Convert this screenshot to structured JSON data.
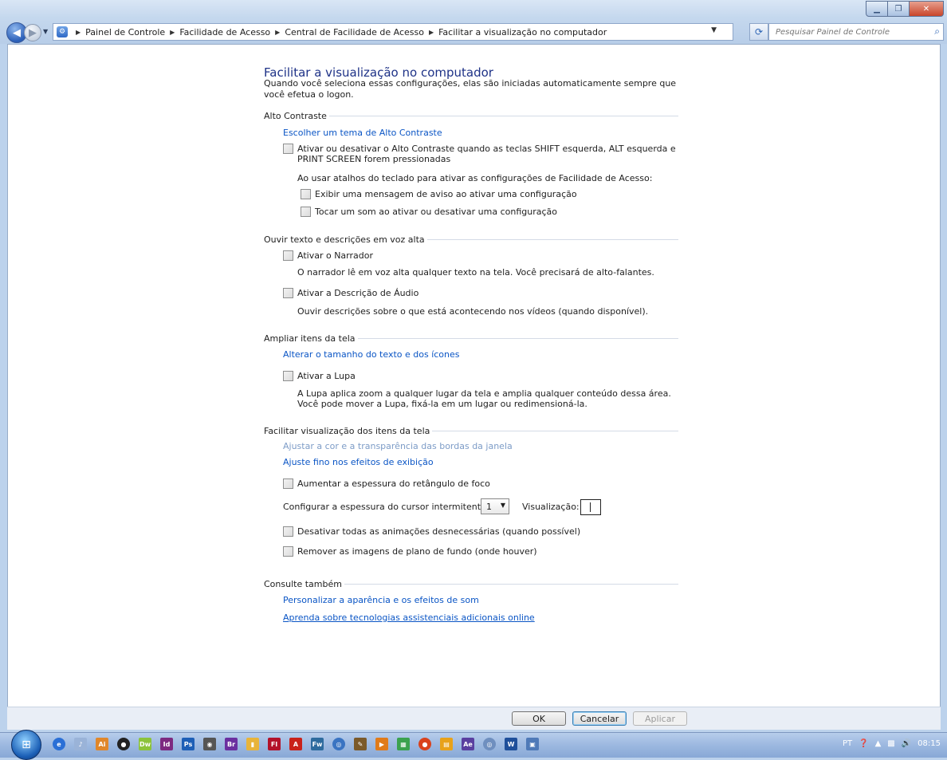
{
  "address": {
    "crumbs": [
      "Painel de Controle",
      "Facilidade de Acesso",
      "Central de Facilidade de Acesso",
      "Facilitar a visualização no computador"
    ],
    "search_placeholder": "Pesquisar Painel de Controle"
  },
  "main": {
    "title": "Facilitar a visualização no computador",
    "intro": "Quando você seleciona essas configurações, elas são iniciadas automaticamente sempre que você efetua o logon."
  },
  "high_contrast": {
    "header": "Alto Contraste",
    "choose_theme_link": "Escolher um tema de Alto Contraste",
    "toggle_checkbox": "Ativar ou desativar o Alto Contraste quando as teclas SHIFT esquerda, ALT esquerda e PRINT SCREEN forem pressionadas",
    "shortcuts_text": "Ao usar atalhos do teclado para ativar as configurações de Facilidade de Acesso:",
    "warning_checkbox": "Exibir uma mensagem de aviso ao ativar uma configuração",
    "sound_checkbox": "Tocar um som ao ativar ou desativar uma configuração"
  },
  "narration": {
    "header": "Ouvir texto e descrições em voz alta",
    "narrator_checkbox": "Ativar o Narrador",
    "narrator_desc": "O narrador lê em voz alta qualquer texto na tela. Você precisará de alto-falantes.",
    "audio_checkbox": "Ativar a Descrição de Áudio",
    "audio_desc": "Ouvir descrições sobre o que está acontecendo nos vídeos (quando disponível)."
  },
  "magnify": {
    "header": "Ampliar itens da tela",
    "size_link": "Alterar o tamanho do texto e dos ícones",
    "magnifier_checkbox": "Ativar a Lupa",
    "magnifier_desc": "A Lupa aplica zoom a qualquer lugar da tela e amplia qualquer conteúdo dessa área. Você pode mover a Lupa, fixá-la em um lugar ou redimensioná-la."
  },
  "visual": {
    "header": "Facilitar visualização dos itens da tela",
    "color_link": "Ajustar a cor e a transparência das bordas da janela",
    "effects_link": "Ajuste fino nos efeitos de exibição",
    "focus_checkbox": "Aumentar a espessura do retângulo de foco",
    "cursor_label": "Configurar a espessura do cursor intermitente:",
    "cursor_value": "1",
    "preview_label": "Visualização:",
    "animations_checkbox": "Desativar todas as animações desnecessárias (quando possível)",
    "background_checkbox": "Remover as imagens de plano de fundo (onde houver)"
  },
  "see_also": {
    "header": "Consulte também",
    "appearance_link": "Personalizar a aparência e os efeitos de som",
    "online_link": "Aprenda sobre tecnologias assistenciais adicionais online"
  },
  "buttons": {
    "ok": "OK",
    "cancel": "Cancelar",
    "apply": "Aplicar"
  },
  "taskbar": {
    "lang": "PT",
    "clock": "08:15"
  }
}
